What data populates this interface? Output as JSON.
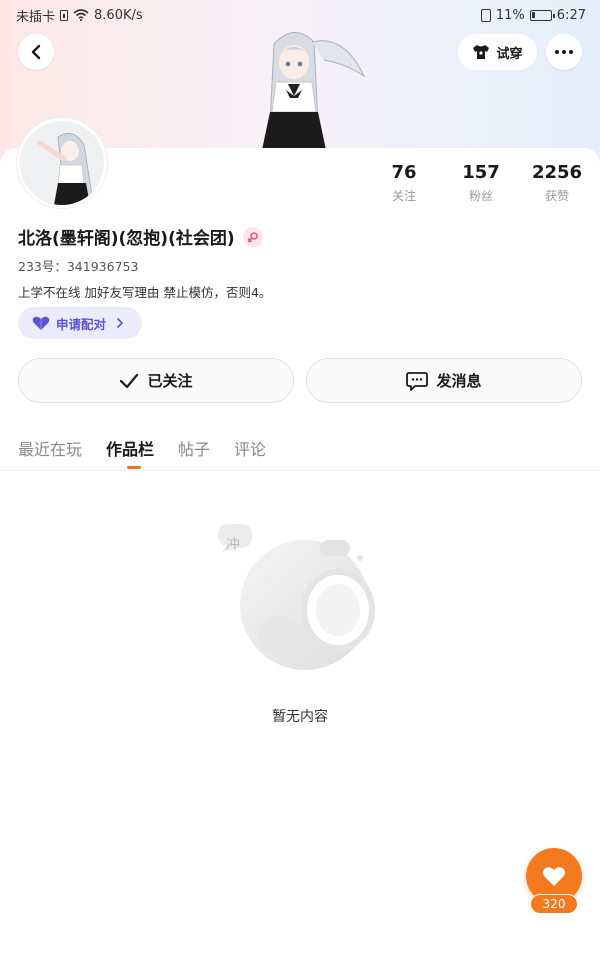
{
  "status_bar": {
    "carrier": "未插卡",
    "network_speed": "8.60K/s",
    "battery_percent": "11%",
    "time": "6:27"
  },
  "nav": {
    "back_icon": "chevron-left-icon",
    "tryon_label": "试穿",
    "tryon_icon": "shirt-icon",
    "more_icon": "more-dots-icon"
  },
  "profile": {
    "name": "北洛(墨轩阁)(忽抱)(社会团)",
    "gender_icon": "female-icon",
    "uid_text": "233号：341936753",
    "bio": "上学不在线 加好友写理由 禁止模仿，否则4。",
    "pair_label": "申请配对",
    "pair_icon": "heart-icon",
    "pair_chevron": "chevron-right-icon"
  },
  "stats": [
    {
      "value": "76",
      "label": "关注"
    },
    {
      "value": "157",
      "label": "粉丝"
    },
    {
      "value": "2256",
      "label": "获赞"
    }
  ],
  "actions": {
    "follow_label": "已关注",
    "follow_icon": "check-icon",
    "message_label": "发消息",
    "message_icon": "chat-bubble-icon"
  },
  "tabs": [
    {
      "label": "最近在玩",
      "active": false
    },
    {
      "label": "作品栏",
      "active": true
    },
    {
      "label": "帖子",
      "active": false
    },
    {
      "label": "评论",
      "active": false
    }
  ],
  "empty": {
    "text": "暂无内容",
    "bubble_char": "冲"
  },
  "fab": {
    "icon": "heart-icon",
    "count": "320"
  },
  "colors": {
    "accent": "#f47a1f",
    "pair_bg": "#ecebfb",
    "pair_text": "#5b55d6"
  }
}
